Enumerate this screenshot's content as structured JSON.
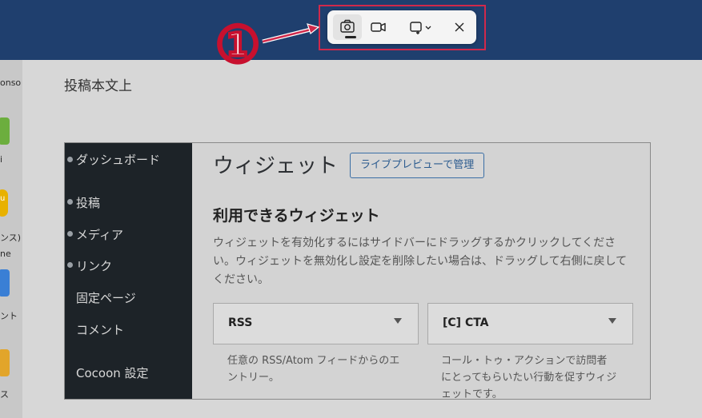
{
  "desktop_labels": [
    "onso",
    "i",
    "u",
    "ンス)",
    "ne",
    "ント",
    "ス"
  ],
  "page": {
    "heading": "投稿本文上"
  },
  "wp_menu": [
    {
      "label": "ダッシュボード"
    },
    {
      "label": "投稿"
    },
    {
      "label": "メディア"
    },
    {
      "label": "リンク"
    },
    {
      "label": "固定ページ"
    },
    {
      "label": "コメント"
    },
    {
      "label": "Cocoon 設定"
    }
  ],
  "widgets": {
    "title": "ウィジェット",
    "preview_button": "ライブプレビューで管理",
    "available_title": "利用できるウィジェット",
    "description": "ウィジェットを有効化するにはサイドバーにドラッグするかクリックしてください。ウィジェットを無効化し設定を削除したい場合は、ドラッグして右側に戻してください。",
    "cards": [
      {
        "label": "RSS",
        "desc": "任意の RSS/Atom フィードからのエントリー。"
      },
      {
        "label": "[C] CTA",
        "desc": "コール・トゥ・アクションで訪問者にとってもらいたい行動を促すウィジェットです。"
      }
    ]
  },
  "annotation": {
    "number": "①",
    "color": "#d0294b"
  },
  "capture_toolbar": {
    "buttons": [
      "camera-icon",
      "video-icon",
      "rect-select-icon",
      "close-icon"
    ]
  }
}
